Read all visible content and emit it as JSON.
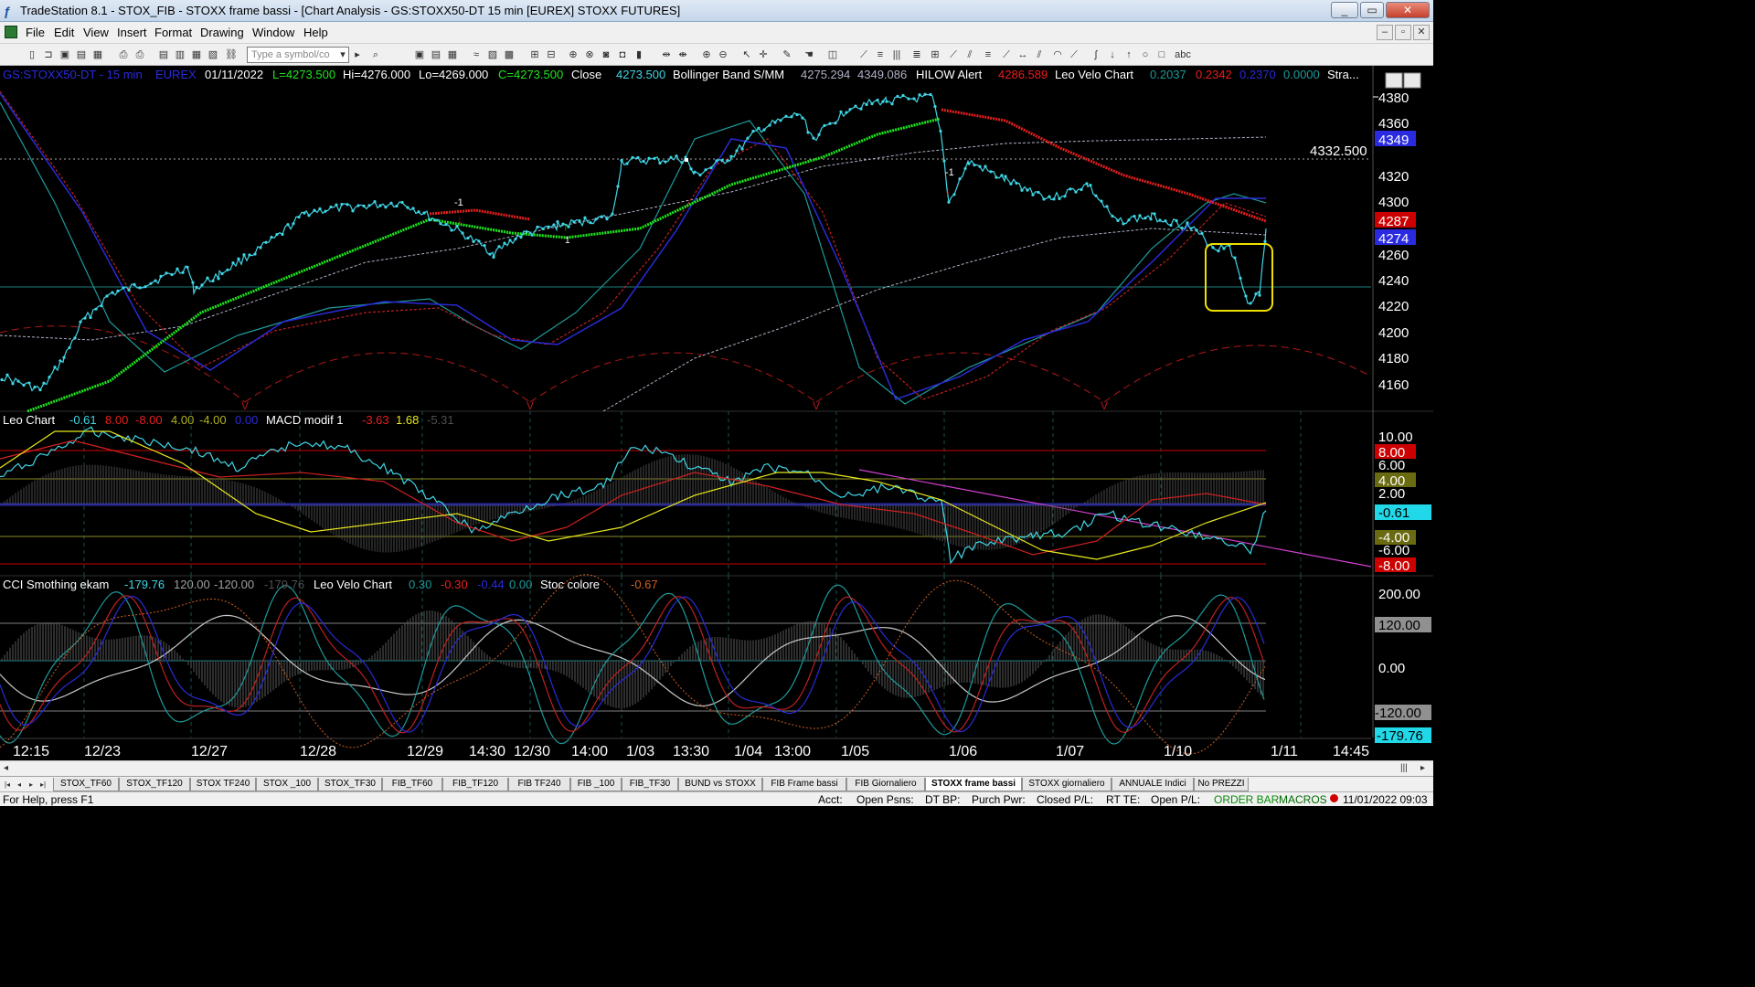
{
  "window": {
    "title": "TradeStation 8.1 - STOX_FIB - STOXX frame bassi - [Chart Analysis - GS:STOXX50-DT  15 min  [EUREX] STOXX FUTURES]",
    "minimize": "_",
    "maximize": "▭",
    "close": "✕"
  },
  "menu": {
    "items": [
      "File",
      "Edit",
      "View",
      "Insert",
      "Format",
      "Drawing",
      "Window",
      "Help"
    ]
  },
  "toolbar": {
    "symbol_placeholder": "Type a symbol/co"
  },
  "chart_header": {
    "symbol": "GS:STOXX50-DT - 15 min",
    "exchange": "EUREX",
    "date": "01/11/2022",
    "last": "L=4273.500",
    "high": "Hi=4276.000",
    "low": "Lo=4269.000",
    "close_eq": "C=4273.500",
    "close_label": "Close",
    "close_val": "4273.500",
    "bb_label": "Bollinger Band S/MM",
    "bb_val1": "4275.294",
    "bb_val2": "4349.086",
    "hilow_label": "HILOW Alert",
    "hilow_val": "4286.589",
    "leo_label": "Leo Velo Chart",
    "leo_v1": "0.2037",
    "leo_v2": "0.2342",
    "leo_v3": "0.2370",
    "leo_v4": "0.0000",
    "stra": "Stra..."
  },
  "panel2_header": {
    "name": "Leo Chart",
    "v1": "-0.61",
    "v2": "8.00",
    "v3": "-8.00",
    "v4": "4.00",
    "v5": "-4.00",
    "v6": "0.00",
    "macd_label": "MACD modif 1",
    "m1": "-3.63",
    "m2": "1.68",
    "m3": "-5.31"
  },
  "panel3_header": {
    "name": "CCI Smothing ekam",
    "v1": "-179.76",
    "v2": "120.00",
    "v3": "-120.00",
    "v4": "-179.76",
    "leo_label": "Leo Velo Chart",
    "l1": "0.30",
    "l2": "-0.30",
    "l3": "-0.44",
    "l4": "0.00",
    "stoc_label": "Stoc colore",
    "s1": "-0.67"
  },
  "price_axis": {
    "ticks": [
      "4380",
      "4360",
      "4349",
      "4320",
      "4300",
      "4287",
      "4274",
      "4260",
      "4240",
      "4220",
      "4200",
      "4180",
      "4160"
    ],
    "hline_label": "4332.500"
  },
  "osc_axis": {
    "ticks": [
      "10.00",
      "8.00",
      "6.00",
      "4.00",
      "2.00",
      "-0.61",
      "-4.00",
      "-6.00",
      "-8.00"
    ]
  },
  "cci_axis": {
    "ticks": [
      "200.00",
      "120.00",
      "0.00",
      "-120.00",
      "-179.76"
    ]
  },
  "time_axis": {
    "labels": [
      "12:15",
      "12/23",
      "12/27",
      "12/28",
      "12/29",
      "14:30",
      "12/30",
      "14:00",
      "1/03",
      "13:30",
      "1/04",
      "13:00",
      "1/05",
      "1/06",
      "1/07",
      "1/10",
      "1/11",
      "14:45"
    ]
  },
  "markers": {
    "m1": "-1",
    "m2": "1",
    "m3": "-1"
  },
  "tabs": [
    "STOX_TF60",
    "STOX_TF120",
    "STOX TF240",
    "STOX _100",
    "STOX_TF30",
    "FIB_TF60",
    "FIB_TF120",
    "FIB TF240",
    "FIB _100",
    "FIB_TF30",
    "BUND vs STOXX",
    "FIB Frame bassi",
    "FIB Giornaliero",
    "STOXX frame bassi",
    "STOXX giornaliero",
    "ANNUALE Indici",
    "No PREZZI"
  ],
  "active_tab": "STOXX frame bassi",
  "status": {
    "help": "For Help, press F1",
    "acct": "Acct:",
    "open_psns": "Open Psns:",
    "dt_bp": "DT BP:",
    "purch_pwr": "Purch Pwr:",
    "closed_pl": "Closed P/L:",
    "rt_te": "RT TE:",
    "open_pl": "Open P/L:",
    "order_bar": "ORDER BAR",
    "macros": "MACROS",
    "datetime": "11/01/2022 09:03"
  },
  "colors": {
    "cyan": "#3fd6e6",
    "green": "#1ee81e",
    "red": "#e81e1e",
    "blue": "#2a2ad8",
    "yellow": "#e8e81e",
    "magenta": "#d040d0",
    "axis_highlight_red": "#cc0000",
    "axis_highlight_blue": "#2a2ae0"
  }
}
